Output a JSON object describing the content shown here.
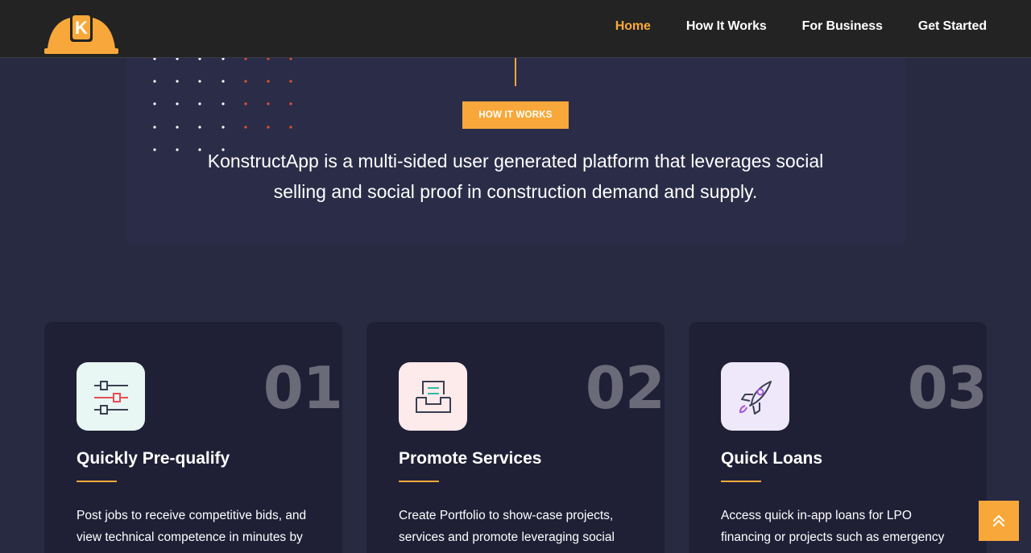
{
  "nav": {
    "items": [
      {
        "label": "Home",
        "active": true
      },
      {
        "label": "How It Works",
        "active": false
      },
      {
        "label": "For Business",
        "active": false
      },
      {
        "label": "Get Started",
        "active": false
      }
    ]
  },
  "logo": {
    "letter": "K"
  },
  "intro": {
    "badge": "HOW IT WORKS",
    "text": "KonstructApp is a multi-sided user generated platform that leverages social selling and social proof in construction demand and supply."
  },
  "cards": [
    {
      "number": "01",
      "title": "Quickly Pre-qualify",
      "icon": "sliders-icon",
      "icon_bg": "#e8f7f3",
      "desc": "Post jobs to receive competitive bids, and view technical competence in minutes by"
    },
    {
      "number": "02",
      "title": "Promote Services",
      "icon": "inbox-icon",
      "icon_bg": "#fdeaea",
      "desc": "Create Portfolio to show-case projects, services and promote leveraging social"
    },
    {
      "number": "03",
      "title": "Quick Loans",
      "icon": "rocket-icon",
      "icon_bg": "#efe8fb",
      "desc": "Access quick in-app loans for LPO financing or projects such as emergency"
    }
  ],
  "colors": {
    "accent": "#f8a83a",
    "background": "#282a42",
    "card": "#1f2036",
    "header": "#232323"
  }
}
